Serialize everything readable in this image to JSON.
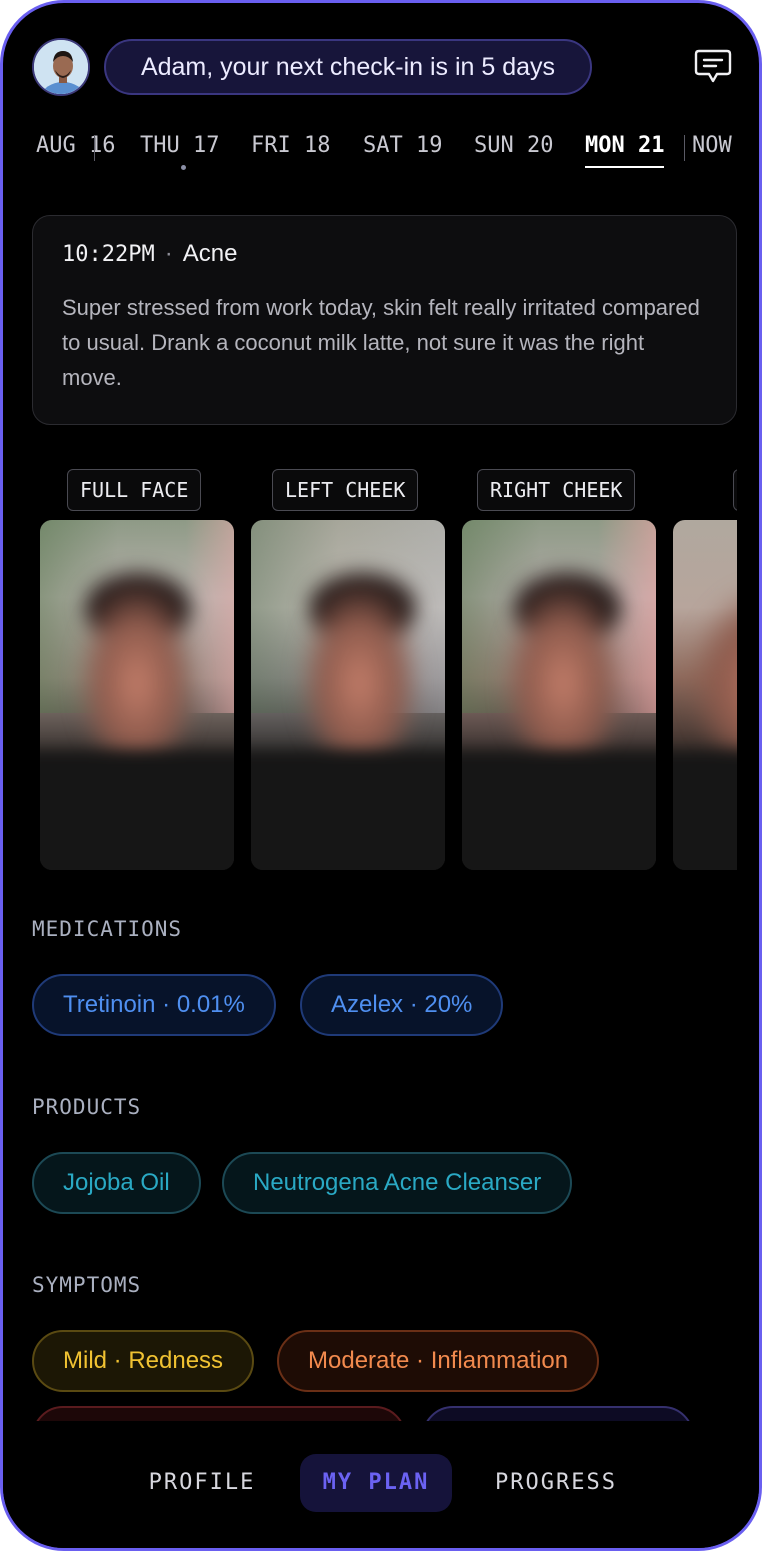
{
  "header": {
    "checkin_message": "Adam, your next check-in is in 5 days"
  },
  "dates": [
    {
      "label": "AUG 16"
    },
    {
      "label": "THU 17"
    },
    {
      "label": "FRI 18"
    },
    {
      "label": "SAT 19"
    },
    {
      "label": "SUN 20"
    },
    {
      "label": "MON 21",
      "selected": true
    },
    {
      "label": "NOW"
    }
  ],
  "note": {
    "time": "10:22PM",
    "condition": "Acne",
    "text": "Super stressed from work today, skin felt really irritated compared to usual. Drank a coconut milk latte, not sure it was the right move."
  },
  "photos": [
    {
      "label": "FULL FACE"
    },
    {
      "label": "LEFT CHEEK"
    },
    {
      "label": "RIGHT CHEEK"
    },
    {
      "label": ""
    }
  ],
  "medications": {
    "heading": "MEDICATIONS",
    "items": [
      "Tretinoin · 0.01%",
      "Azelex · 20%"
    ]
  },
  "products": {
    "heading": "PRODUCTS",
    "items": [
      "Jojoba Oil",
      "Neutrogena Acne Cleanser"
    ]
  },
  "symptoms": {
    "heading": "SYMPTOMS",
    "items": [
      "Mild · Redness",
      "Moderate · Inflammation"
    ]
  },
  "nav": {
    "profile": "PROFILE",
    "my_plan": "MY PLAN",
    "progress": "PROGRESS",
    "active": "my_plan"
  },
  "colors": {
    "accent": "#6b62f2",
    "frame": "#6a5ff0",
    "medication_text": "#4f8ff0",
    "product_text": "#2aa9c4",
    "mild_text": "#f0c232",
    "moderate_text": "#f28a4e"
  }
}
